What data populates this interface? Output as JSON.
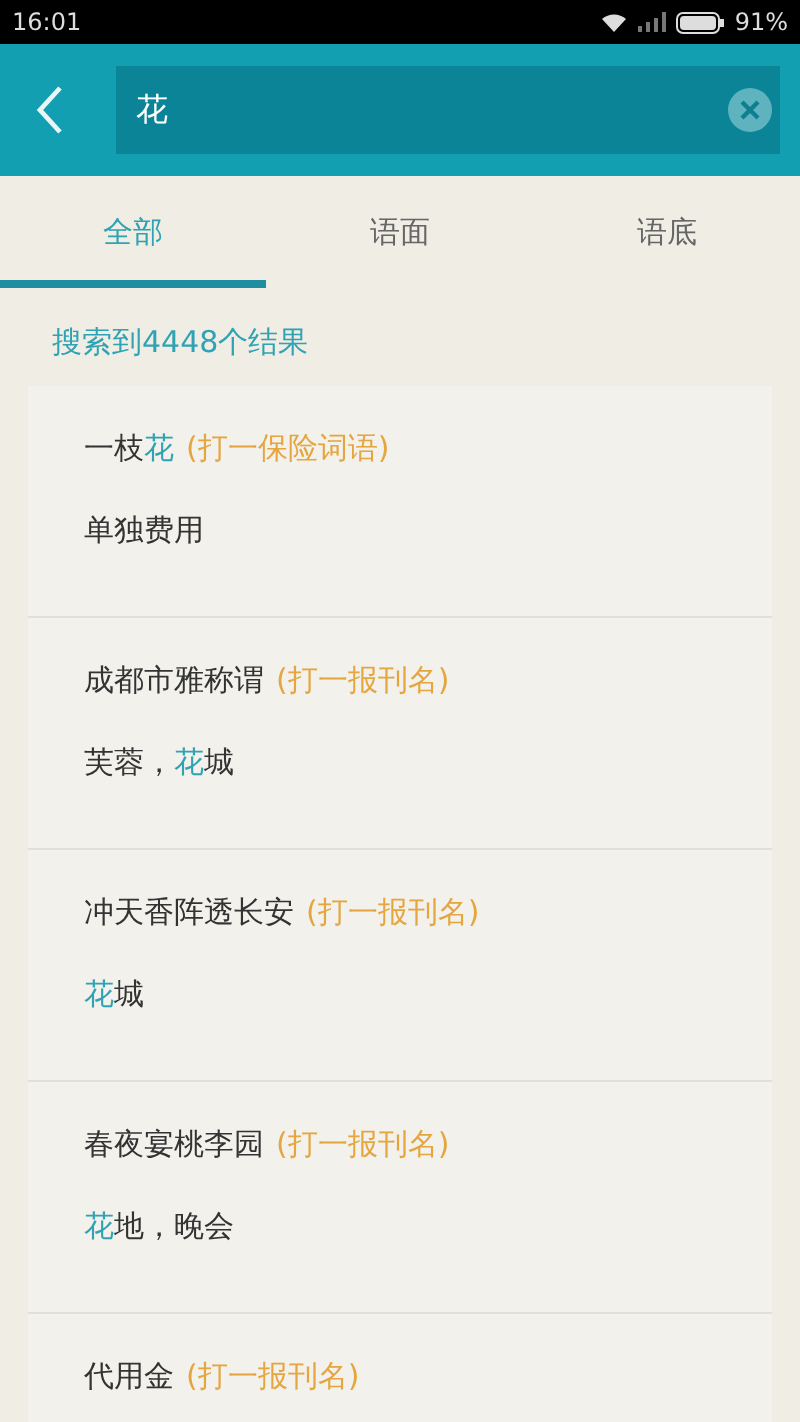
{
  "status_bar": {
    "time": "16:01",
    "battery": "91%"
  },
  "search": {
    "value": "花"
  },
  "tabs": [
    {
      "label": "全部",
      "selected": true
    },
    {
      "label": "语面",
      "selected": false
    },
    {
      "label": "语底",
      "selected": false
    }
  ],
  "result_count": "搜索到4448个结果",
  "results": [
    {
      "riddle": [
        {
          "text": "一枝",
          "match": false
        },
        {
          "text": "花",
          "match": true
        }
      ],
      "hint": "(打一保险词语)",
      "answer": [
        {
          "text": "单独费用",
          "match": false
        }
      ]
    },
    {
      "riddle": [
        {
          "text": "成都市雅称谓",
          "match": false
        }
      ],
      "hint": "(打一报刊名)",
      "answer": [
        {
          "text": "芙蓉，",
          "match": false
        },
        {
          "text": "花",
          "match": true
        },
        {
          "text": "城",
          "match": false
        }
      ]
    },
    {
      "riddle": [
        {
          "text": "冲天香阵透长安",
          "match": false
        }
      ],
      "hint": "(打一报刊名)",
      "answer": [
        {
          "text": "花",
          "match": true
        },
        {
          "text": "城",
          "match": false
        }
      ]
    },
    {
      "riddle": [
        {
          "text": "春夜宴桃李园",
          "match": false
        }
      ],
      "hint": "(打一报刊名)",
      "answer": [
        {
          "text": "花",
          "match": true
        },
        {
          "text": "地，晚会",
          "match": false
        }
      ]
    },
    {
      "riddle": [
        {
          "text": "代用金",
          "match": false
        }
      ],
      "hint": "(打一报刊名)"
    }
  ]
}
